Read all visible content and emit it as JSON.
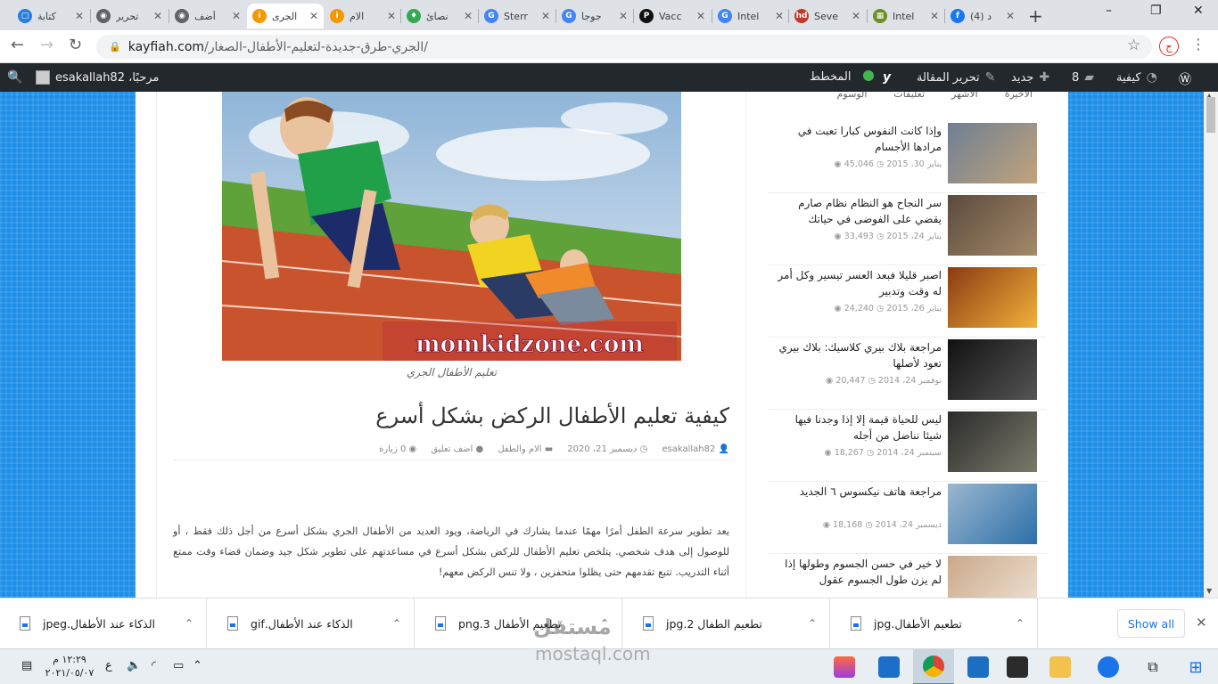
{
  "browser": {
    "tabs": [
      {
        "label": "كتابة",
        "color": "#2a7de1",
        "glyph": "▢"
      },
      {
        "label": "تحرير",
        "color": "#5f6368",
        "glyph": "◉"
      },
      {
        "label": "أضف",
        "color": "#5f6368",
        "glyph": "◉"
      },
      {
        "label": "الجرى",
        "color": "#f29900",
        "glyph": "i",
        "active": true
      },
      {
        "label": "الام",
        "color": "#f29900",
        "glyph": "i"
      },
      {
        "label": "نصائ",
        "color": "#34a853",
        "glyph": "♦"
      },
      {
        "label": "Sterr",
        "color": "#4285f4",
        "glyph": "G"
      },
      {
        "label": "جوجا",
        "color": "#4285f4",
        "glyph": "G"
      },
      {
        "label": "Vacc",
        "color": "#111111",
        "glyph": "P"
      },
      {
        "label": "Intel",
        "color": "#4285f4",
        "glyph": "G"
      },
      {
        "label": "Seve",
        "color": "#c0392b",
        "glyph": "hd"
      },
      {
        "label": "Intel",
        "color": "#6b8e23",
        "glyph": "▦"
      },
      {
        "label": "(4) د",
        "color": "#1877f2",
        "glyph": "f"
      }
    ],
    "new_tab": "+",
    "window_controls": [
      "–",
      "❐",
      "✕"
    ],
    "url_host": "kayfiah.com",
    "url_path": "/الجري-طرق-جديدة-لتعليم-الأطفال-الصغار/",
    "profile_initial": "ج"
  },
  "wpbar": {
    "site_name": "كيفية",
    "comments_count": "8",
    "new_label": "جديد",
    "edit_label": "تحرير المقالة",
    "schema_label": "المخطط",
    "greeting": "مرحبًا، esakallah82"
  },
  "post": {
    "image_watermark": "momkidzone.com",
    "caption": "تعليم الأطفال الجري",
    "title": "كيفية تعليم الأطفال الركض بشكل أسرع",
    "meta": {
      "author": "esakallah82",
      "date": "ديسمبر 21، 2020",
      "category": "الام والطفل",
      "comment": "اضف تعليق",
      "views": "0 زيارة"
    },
    "body": "يعد تطوير سرعة الطفل أمرًا مهمًا عندما يشارك في الرياضة، ويود العديد من الأطفال الجري بشكل أسرع من أجل ذلك فقط ، أو للوصول إلى هدف شخصي. يتلخص تعليم الأطفال للركض بشكل أسرع في مساعدتهم على تطوير شكل جيد وضمان قضاء وقت ممتع أثناء التدريب. تتبع تقدمهم حتى يظلوا متحفزين ، ولا تنس الركض معهم!"
  },
  "sidebar": {
    "tabs": [
      "الأخيرة",
      "الأشهر",
      "تعليقات",
      "الوسوم"
    ],
    "items": [
      {
        "title": "وإذا كانت النفوس كبارا تعبت في مرادها الأجسام",
        "date": "يناير 30، 2015",
        "views": "45,046",
        "thumb": [
          "#6d7f95",
          "#c2a37a"
        ]
      },
      {
        "title": "سر النجاح هو النظام نظام صارم يقضي على الفوضى في حياتك",
        "date": "يناير 24، 2015",
        "views": "33,493",
        "thumb": [
          "#5b4a3c",
          "#a58a6a"
        ]
      },
      {
        "title": "اصبر قليلا فبعد العسر تيسير وكل أمر له وقت وتدبير",
        "date": "يناير 26، 2015",
        "views": "24,240",
        "thumb": [
          "#8a3b12",
          "#f2b13a"
        ]
      },
      {
        "title": "مراجعة بلاك بيري كلاسيك: بلاك بيري تعود لأصلها",
        "date": "نوفمبر 24، 2014",
        "views": "20,447",
        "thumb": [
          "#111111",
          "#555555"
        ]
      },
      {
        "title": "ليس للحياة قيمة إلا إذا وجدنا فيها شيئا نناضل من أجله",
        "date": "سبتمبر 24، 2014",
        "views": "18,267",
        "thumb": [
          "#2b2b2b",
          "#7a7a6a"
        ]
      },
      {
        "title": "مراجعة هاتف نيكسوس ٦ الجديد",
        "date": "ديسمبر 24، 2014",
        "views": "18,168",
        "thumb": [
          "#9bb7cf",
          "#2b6fa8"
        ]
      },
      {
        "title": "لا خير في حسن الجسوم وطولها إذا لم يزن طول الجسوم عقول",
        "date": "",
        "views": "",
        "thumb": [
          "#c9a98a",
          "#f1e4d6"
        ]
      }
    ]
  },
  "downloads": {
    "items": [
      {
        "name": "الذكاء عند الأطفال.jpeg"
      },
      {
        "name": "الذكاء عند الأطفال.gif"
      },
      {
        "name": "تطعيم الأطفال 3.png"
      },
      {
        "name": "تطعيم الطفال 2.jpg"
      },
      {
        "name": "تطعيم الأطفال.jpg"
      }
    ],
    "show_all": "Show all"
  },
  "taskbar": {
    "time": "١٢:٢٩ م",
    "date": "٢٠٢١/٠٥/٠٧",
    "lang": "ع",
    "notif_count": "1"
  },
  "overlay": {
    "watermark_ar": "مستقل",
    "watermark_en": "mostaql.com"
  }
}
